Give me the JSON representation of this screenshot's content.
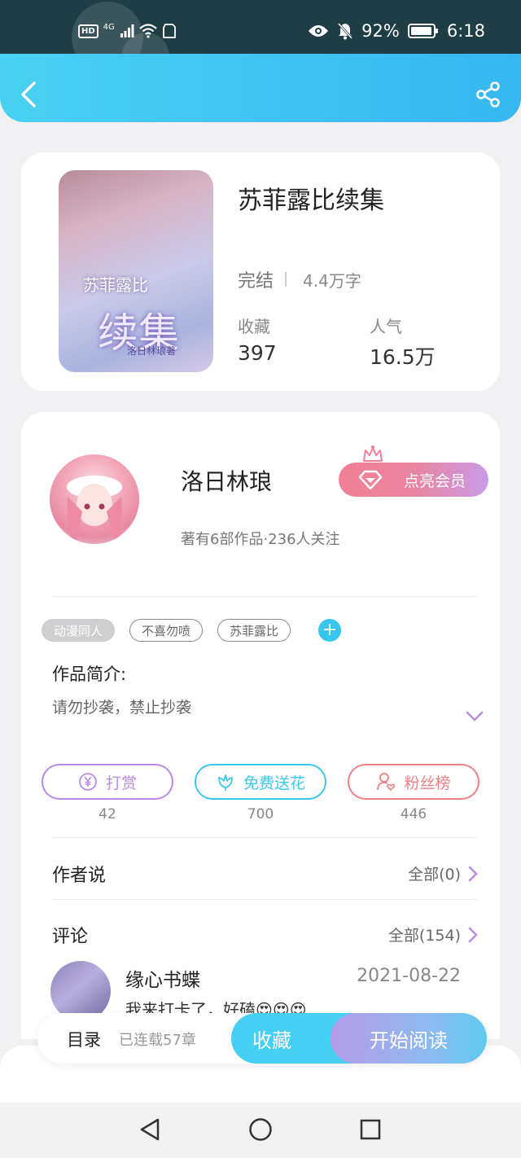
{
  "status_bar": {
    "network": "4G",
    "battery": "92%",
    "time": "6:18",
    "icons": [
      "hd-icon",
      "signal-icon",
      "wifi-icon",
      "sim-icon",
      "eye-icon",
      "mute-bell-icon",
      "battery-icon"
    ]
  },
  "header": {
    "back_icon": "chevron-left-icon",
    "share_icon": "share-icon",
    "color": "#3bc3f1"
  },
  "book": {
    "cover_text_top": "苏菲露比",
    "cover_text_main": "续集",
    "cover_text_author": "洛日林琅著",
    "title": "苏菲露比续集",
    "status": "完结",
    "word_count": "4.4万字",
    "favorites_label": "收藏",
    "favorites_value": "397",
    "popularity_label": "人气",
    "popularity_value": "16.5万"
  },
  "author": {
    "name": "洛日林琅",
    "meta": "著有6部作品·236人关注",
    "vip_button": "点亮会员"
  },
  "tags": [
    "动漫同人",
    "不喜勿喷",
    "苏菲露比"
  ],
  "intro": {
    "title": "作品简介:",
    "text": "请勿抄袭，禁止抄袭"
  },
  "actions": [
    {
      "label": "打赏",
      "count": "42",
      "color": "#b98be3",
      "icon": "yen-coin-icon"
    },
    {
      "label": "免费送花",
      "count": "700",
      "color": "#3cc7ec",
      "icon": "flower-icon"
    },
    {
      "label": "粉丝榜",
      "count": "446",
      "color": "#ef7f86",
      "icon": "fan-rank-icon"
    }
  ],
  "author_says": {
    "title": "作者说",
    "link": "全部(0)"
  },
  "comments": {
    "title": "评论",
    "link": "全部(154)",
    "first": {
      "user": "缘心书蝶",
      "date": "2021-08-22",
      "text": "我来打卡了，好磕😍😍😍"
    }
  },
  "bottom_bar": {
    "toc": "目录",
    "serial": "已连载57章",
    "favorite": "收藏",
    "read": "开始阅读"
  },
  "nav_bar": {
    "icons": [
      "back-triangle-icon",
      "home-circle-icon",
      "recent-square-icon"
    ]
  }
}
